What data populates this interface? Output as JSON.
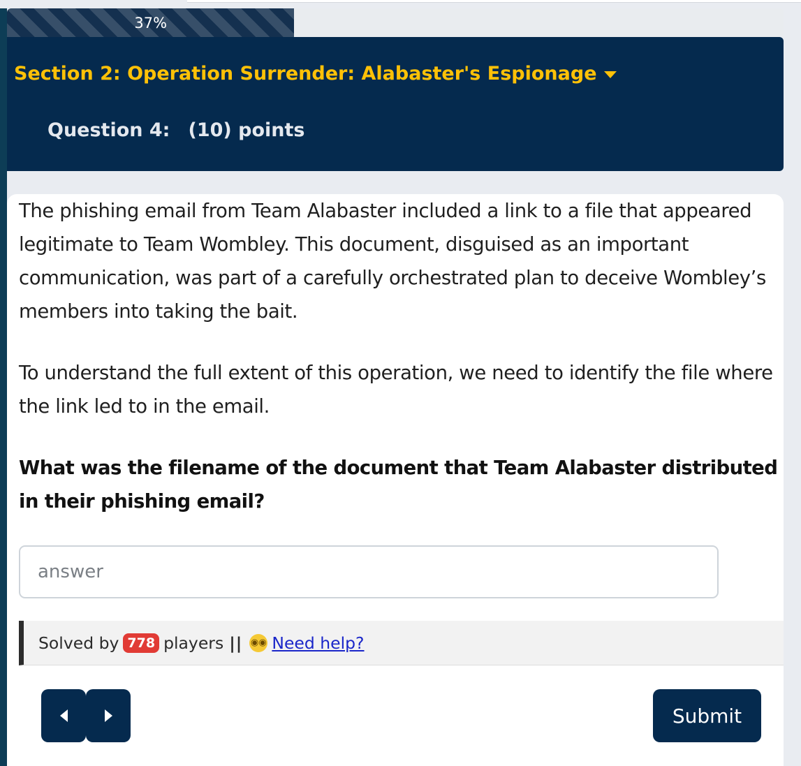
{
  "progress": {
    "label": "37%",
    "value_percent": 37
  },
  "header": {
    "section_title": "Section 2: Operation Surrender: Alabaster's Espionage",
    "question_label": "Question 4:",
    "points_label": "(10) points"
  },
  "question": {
    "paragraph_1": "The phishing email from Team Alabaster included a link to a file that appeared legitimate to Team Wombley. This document, disguised as an important communication, was part of a carefully orchestrated plan to deceive Wombley’s members into taking the bait.",
    "paragraph_2": "To understand the full extent of this operation, we need to identify the file where the link led to in the email.",
    "prompt": "What was the filename of the document that Team Alabaster distributed in their phishing email?"
  },
  "answer": {
    "placeholder": "answer",
    "value": ""
  },
  "solved": {
    "prefix": "Solved by",
    "count": "778",
    "suffix": "players",
    "separator": "||",
    "help_icon": "dizzy-face-emoji",
    "help_link": "Need help?"
  },
  "buttons": {
    "submit_label": "Submit"
  },
  "colors": {
    "navy": "#052a4e",
    "accent_yellow": "#ffc107",
    "badge_red": "#e13b35",
    "link_blue": "#1a26c9"
  }
}
